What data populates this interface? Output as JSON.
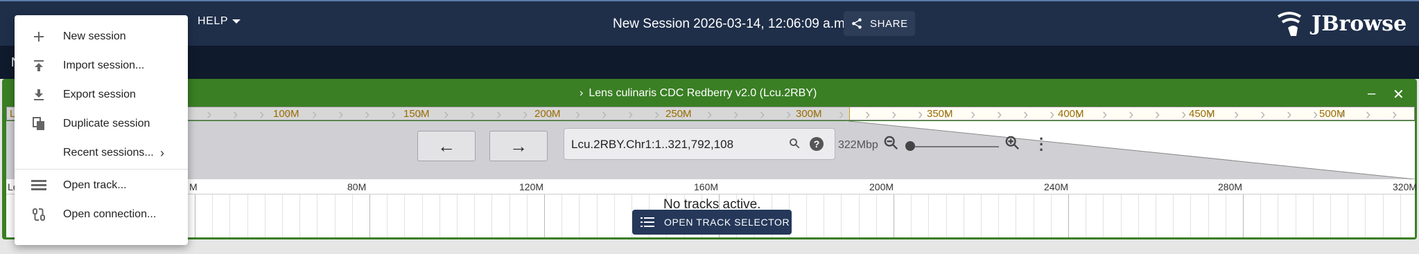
{
  "appbar": {
    "help_label": "HELP",
    "session_title": "New Session 2026-03-14, 12:06:09 a.m.",
    "share_label": "SHARE",
    "logo_text": "JBrowse"
  },
  "secondbar": {
    "stub_text": "N"
  },
  "view": {
    "title": "Lens culinaris CDC Redberry v2.0 (Lcu.2RBY)",
    "overview_labels": [
      "100M",
      "150M",
      "200M",
      "250M",
      "300M",
      "350M",
      "400M",
      "450M",
      "500M"
    ],
    "location": "Lcu.2RBY.Chr1:1..321,792,108",
    "bp_count": "322Mbp",
    "ruler_labels": [
      "80M",
      "120M",
      "160M",
      "200M",
      "240M",
      "280M",
      "320M"
    ],
    "ruler_edge_left": "Lc",
    "ruler_edge_mid": "M",
    "no_tracks": "No tracks active.",
    "open_track_selector": "OPEN TRACK SELECTOR",
    "overview_edge": "L"
  },
  "menu": {
    "items": [
      {
        "label": "New session",
        "icon": "plus-icon"
      },
      {
        "label": "Import session...",
        "icon": "upload-icon"
      },
      {
        "label": "Export session",
        "icon": "download-icon"
      },
      {
        "label": "Duplicate session",
        "icon": "copy-icon"
      },
      {
        "label": "Recent sessions...",
        "icon": "none"
      },
      {
        "label": "Open track...",
        "icon": "track-list-icon"
      },
      {
        "label": "Open connection...",
        "icon": "connection-icon"
      }
    ]
  },
  "colors": {
    "appbar": "#1f2f4a",
    "view_border": "#3a7f24",
    "overview_accent": "#c79c1e"
  }
}
